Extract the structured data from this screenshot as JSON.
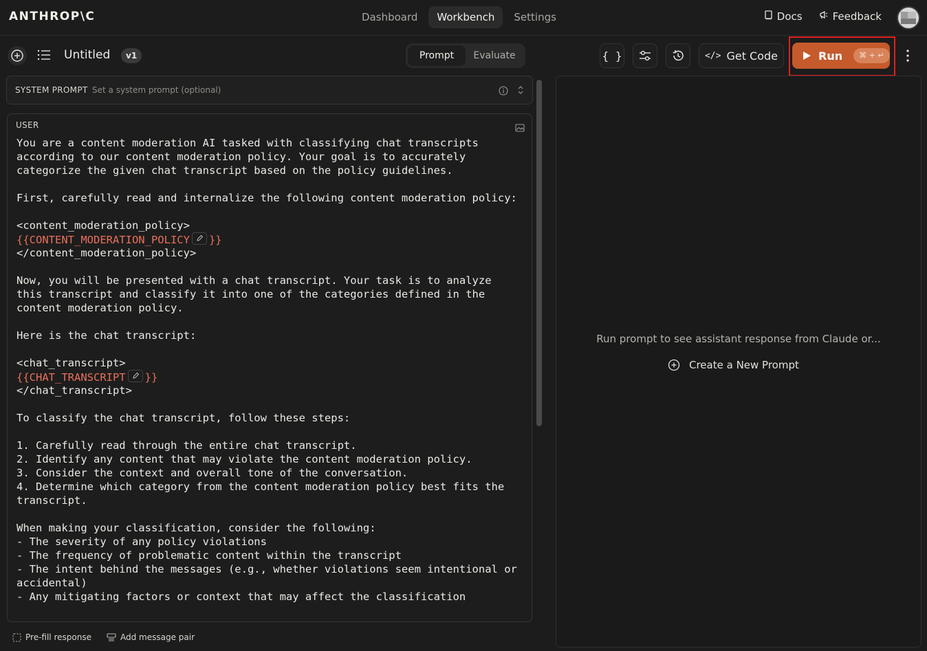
{
  "brand": {
    "logo_text": "ANTHROP\\C"
  },
  "nav": {
    "items": [
      "Dashboard",
      "Workbench",
      "Settings"
    ],
    "active": "Workbench"
  },
  "top_links": {
    "docs": "Docs",
    "feedback": "Feedback"
  },
  "toolbar": {
    "title": "Untitled",
    "version": "v1",
    "tabs": [
      "Prompt",
      "Evaluate"
    ],
    "active_tab": "Prompt",
    "get_code": "Get Code",
    "run": "Run",
    "run_shortcut": "⌘ + ↵"
  },
  "system_prompt": {
    "label": "SYSTEM PROMPT",
    "placeholder": "Set a system prompt (optional)"
  },
  "user": {
    "label": "USER",
    "lines": [
      "You are a content moderation AI tasked with classifying chat transcripts",
      "according to our content moderation policy. Your goal is to accurately",
      "categorize the given chat transcript based on the policy guidelines.",
      "",
      "First, carefully read and internalize the following content moderation policy:",
      "",
      "<content_moderation_policy>",
      "{{VAR:CONTENT_MODERATION_POLICY}}",
      "</content_moderation_policy>",
      "",
      "Now, you will be presented with a chat transcript. Your task is to analyze",
      "this transcript and classify it into one of the categories defined in the",
      "content moderation policy.",
      "",
      "Here is the chat transcript:",
      "",
      "<chat_transcript>",
      "{{VAR:CHAT_TRANSCRIPT}}",
      "</chat_transcript>",
      "",
      "To classify the chat transcript, follow these steps:",
      "",
      "1. Carefully read through the entire chat transcript.",
      "2. Identify any content that may violate the content moderation policy.",
      "3. Consider the context and overall tone of the conversation.",
      "4. Determine which category from the content moderation policy best fits the",
      "transcript.",
      "",
      "When making your classification, consider the following:",
      "- The severity of any policy violations",
      "- The frequency of problematic content within the transcript",
      "- The intent behind the messages (e.g., whether violations seem intentional or",
      "accidental)",
      "- Any mitigating factors or context that may affect the classification"
    ]
  },
  "bottom": {
    "prefill": "Pre-fill response",
    "add_pair": "Add message pair"
  },
  "response": {
    "empty_message": "Run prompt to see assistant response from Claude or...",
    "new_prompt": "Create a New Prompt"
  },
  "colors": {
    "accent": "#c55a2c",
    "variable": "#e8705a",
    "highlight_box": "#e02020"
  }
}
